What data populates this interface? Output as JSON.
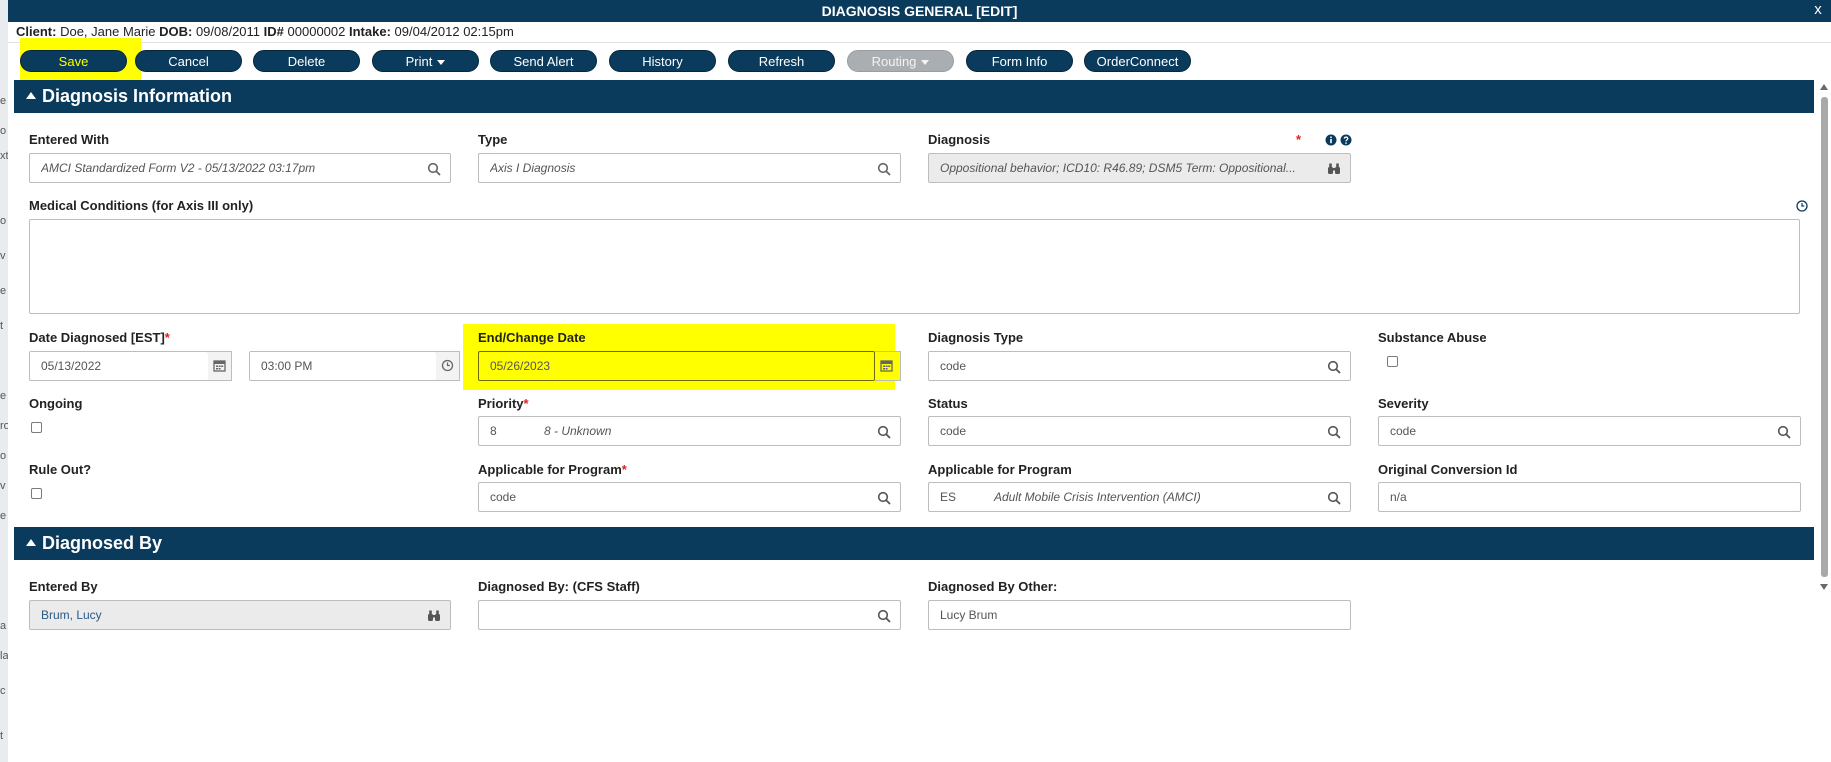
{
  "window": {
    "title": "DIAGNOSIS GENERAL [EDIT]",
    "close": "x"
  },
  "client": {
    "client_label": "Client:",
    "client_name": "Doe, Jane Marie",
    "dob_label": "DOB:",
    "dob": "09/08/2011",
    "id_label": "ID#",
    "id": "00000002",
    "intake_label": "Intake:",
    "intake": "09/04/2012 02:15pm"
  },
  "toolbar": {
    "save": "Save",
    "cancel": "Cancel",
    "delete": "Delete",
    "print": "Print",
    "send_alert": "Send Alert",
    "history": "History",
    "refresh": "Refresh",
    "routing": "Routing",
    "form_info": "Form Info",
    "order_connect": "OrderConnect"
  },
  "section1": {
    "title": "Diagnosis Information",
    "entered_with": {
      "label": "Entered With",
      "value": "AMCI Standardized Form V2 - 05/13/2022 03:17pm"
    },
    "type": {
      "label": "Type",
      "value": "Axis I Diagnosis"
    },
    "diagnosis": {
      "label": "Diagnosis",
      "required": "*",
      "value": "Oppositional behavior; ICD10: R46.89; DSM5 Term: Oppositional..."
    },
    "medical_conditions": {
      "label": "Medical Conditions (for Axis III only)"
    },
    "date_diagnosed": {
      "label": "Date Diagnosed [EST]",
      "required": "*",
      "date": "05/13/2022",
      "time": "03:00 PM"
    },
    "end_change_date": {
      "label": "End/Change Date",
      "value": "05/26/2023"
    },
    "diagnosis_type": {
      "label": "Diagnosis Type",
      "placeholder": "code"
    },
    "substance_abuse": {
      "label": "Substance Abuse"
    },
    "ongoing": {
      "label": "Ongoing"
    },
    "priority": {
      "label": "Priority",
      "required": "*",
      "code": "8",
      "desc": "8 - Unknown"
    },
    "status": {
      "label": "Status",
      "placeholder": "code"
    },
    "severity": {
      "label": "Severity",
      "placeholder": "code"
    },
    "rule_out": {
      "label": "Rule Out?"
    },
    "applicable_program_req": {
      "label": "Applicable for Program",
      "required": "*",
      "placeholder": "code"
    },
    "applicable_program": {
      "label": "Applicable for Program",
      "code": "ES",
      "desc": "Adult Mobile Crisis Intervention (AMCI)"
    },
    "original_conversion_id": {
      "label": "Original Conversion Id",
      "value": "n/a"
    }
  },
  "section2": {
    "title": "Diagnosed By",
    "entered_by": {
      "label": "Entered By",
      "value": "Brum, Lucy"
    },
    "diagnosed_by_staff": {
      "label": "Diagnosed By: (CFS Staff)"
    },
    "diagnosed_by_other": {
      "label": "Diagnosed By Other:",
      "value": "Lucy Brum"
    }
  },
  "colors": {
    "navy": "#0a3a5c",
    "highlight": "#ffff00",
    "required": "#e02020"
  }
}
